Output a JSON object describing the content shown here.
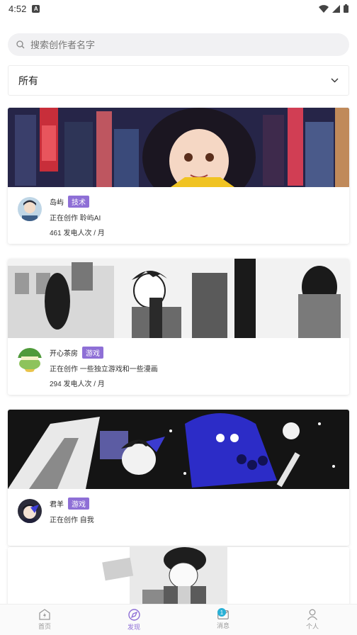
{
  "status_bar": {
    "time": "4:52",
    "notif_glyph": "A"
  },
  "search": {
    "placeholder": "搜索创作者名字"
  },
  "filter": {
    "selected": "所有"
  },
  "cards": [
    {
      "name": "岛屿",
      "tag": "技术",
      "creating": "正在创作 聆屿AI",
      "stats": "461 发电人次 / 月"
    },
    {
      "name": "开心茶房",
      "tag": "游戏",
      "creating": "正在创作 一些独立游戏和一些漫画",
      "stats": "294 发电人次 / 月"
    },
    {
      "name": "君羊",
      "tag": "游戏",
      "creating": "正在创作 自我",
      "stats": ""
    }
  ],
  "tabbar": {
    "items": [
      {
        "label": "首页",
        "icon": "home-bolt-icon"
      },
      {
        "label": "发现",
        "icon": "discover-icon"
      },
      {
        "label": "消息",
        "icon": "mail-icon",
        "badge": "1"
      },
      {
        "label": "个人",
        "icon": "person-icon"
      }
    ],
    "active_color": "#8e6fd6",
    "badge_color": "#2ab1d6"
  }
}
